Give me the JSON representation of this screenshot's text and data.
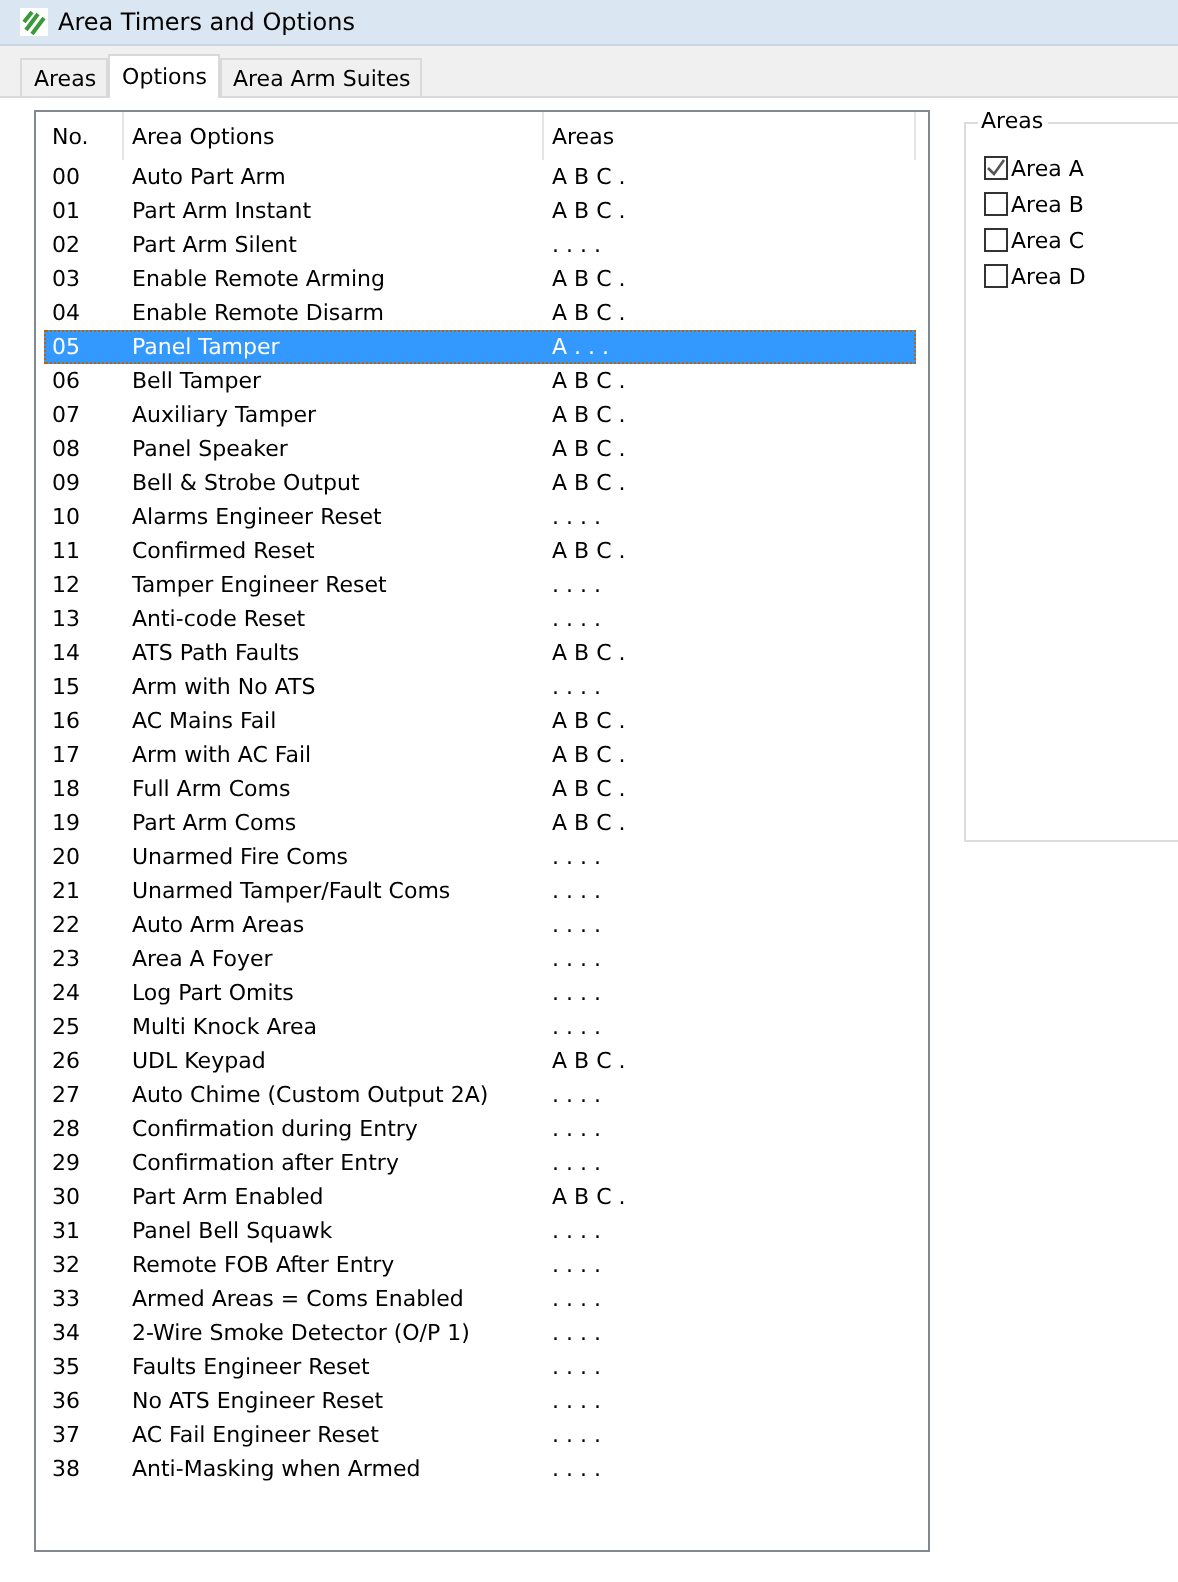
{
  "window": {
    "title": "Area Timers and Options"
  },
  "tabs": [
    {
      "label": "Areas",
      "selected": false
    },
    {
      "label": "Options",
      "selected": true
    },
    {
      "label": "Area Arm Suites",
      "selected": false
    }
  ],
  "table": {
    "columns": [
      "No.",
      "Area Options",
      "Areas"
    ],
    "rows": [
      {
        "no": "00",
        "option": "Auto Part Arm",
        "areas": "A B C .",
        "selected": false
      },
      {
        "no": "01",
        "option": "Part Arm Instant",
        "areas": "A B C .",
        "selected": false
      },
      {
        "no": "02",
        "option": "Part Arm Silent",
        "areas": ". . . .",
        "selected": false
      },
      {
        "no": "03",
        "option": "Enable Remote Arming",
        "areas": "A B C .",
        "selected": false
      },
      {
        "no": "04",
        "option": "Enable Remote Disarm",
        "areas": "A B C .",
        "selected": false
      },
      {
        "no": "05",
        "option": "Panel Tamper",
        "areas": "A . . .",
        "selected": true
      },
      {
        "no": "06",
        "option": "Bell Tamper",
        "areas": "A B C .",
        "selected": false
      },
      {
        "no": "07",
        "option": "Auxiliary Tamper",
        "areas": "A B C .",
        "selected": false
      },
      {
        "no": "08",
        "option": "Panel Speaker",
        "areas": "A B C .",
        "selected": false
      },
      {
        "no": "09",
        "option": "Bell & Strobe Output",
        "areas": "A B C .",
        "selected": false
      },
      {
        "no": "10",
        "option": "Alarms Engineer Reset",
        "areas": ". . . .",
        "selected": false
      },
      {
        "no": "11",
        "option": "Confirmed Reset",
        "areas": "A B C .",
        "selected": false
      },
      {
        "no": "12",
        "option": "Tamper Engineer Reset",
        "areas": ". . . .",
        "selected": false
      },
      {
        "no": "13",
        "option": "Anti-code Reset",
        "areas": ". . . .",
        "selected": false
      },
      {
        "no": "14",
        "option": "ATS Path Faults",
        "areas": "A B C .",
        "selected": false
      },
      {
        "no": "15",
        "option": "Arm with No ATS",
        "areas": ". . . .",
        "selected": false
      },
      {
        "no": "16",
        "option": "AC Mains Fail",
        "areas": "A B C .",
        "selected": false
      },
      {
        "no": "17",
        "option": "Arm with AC Fail",
        "areas": "A B C .",
        "selected": false
      },
      {
        "no": "18",
        "option": "Full Arm Coms",
        "areas": "A B C .",
        "selected": false
      },
      {
        "no": "19",
        "option": "Part Arm Coms",
        "areas": "A B C .",
        "selected": false
      },
      {
        "no": "20",
        "option": "Unarmed Fire Coms",
        "areas": ". . . .",
        "selected": false
      },
      {
        "no": "21",
        "option": "Unarmed Tamper/Fault Coms",
        "areas": ". . . .",
        "selected": false
      },
      {
        "no": "22",
        "option": "Auto Arm Areas",
        "areas": ". . . .",
        "selected": false
      },
      {
        "no": "23",
        "option": "Area A Foyer",
        "areas": ". . . .",
        "selected": false
      },
      {
        "no": "24",
        "option": "Log Part Omits",
        "areas": ". . . .",
        "selected": false
      },
      {
        "no": "25",
        "option": "Multi Knock Area",
        "areas": ". . . .",
        "selected": false
      },
      {
        "no": "26",
        "option": "UDL Keypad",
        "areas": "A B C .",
        "selected": false
      },
      {
        "no": "27",
        "option": "Auto Chime (Custom Output 2A)",
        "areas": ". . . .",
        "selected": false
      },
      {
        "no": "28",
        "option": "Confirmation during Entry",
        "areas": ". . . .",
        "selected": false
      },
      {
        "no": "29",
        "option": "Confirmation after Entry",
        "areas": ". . . .",
        "selected": false
      },
      {
        "no": "30",
        "option": "Part Arm Enabled",
        "areas": "A B C .",
        "selected": false
      },
      {
        "no": "31",
        "option": "Panel Bell Squawk",
        "areas": ". . . .",
        "selected": false
      },
      {
        "no": "32",
        "option": "Remote FOB After Entry",
        "areas": ". . . .",
        "selected": false
      },
      {
        "no": "33",
        "option": "Armed Areas = Coms Enabled",
        "areas": ". . . .",
        "selected": false
      },
      {
        "no": "34",
        "option": "2-Wire Smoke Detector (O/P 1)",
        "areas": ". . . .",
        "selected": false
      },
      {
        "no": "35",
        "option": "Faults Engineer Reset",
        "areas": ". . . .",
        "selected": false
      },
      {
        "no": "36",
        "option": "No ATS Engineer Reset",
        "areas": ". . . .",
        "selected": false
      },
      {
        "no": "37",
        "option": "AC Fail Engineer Reset",
        "areas": ". . . .",
        "selected": false
      },
      {
        "no": "38",
        "option": "Anti-Masking when Armed",
        "areas": ". . . .",
        "selected": false
      }
    ]
  },
  "areas_group": {
    "title": "Areas",
    "items": [
      {
        "label": "Area A",
        "checked": true
      },
      {
        "label": "Area B",
        "checked": false
      },
      {
        "label": "Area C",
        "checked": false
      },
      {
        "label": "Area D",
        "checked": false
      }
    ]
  }
}
